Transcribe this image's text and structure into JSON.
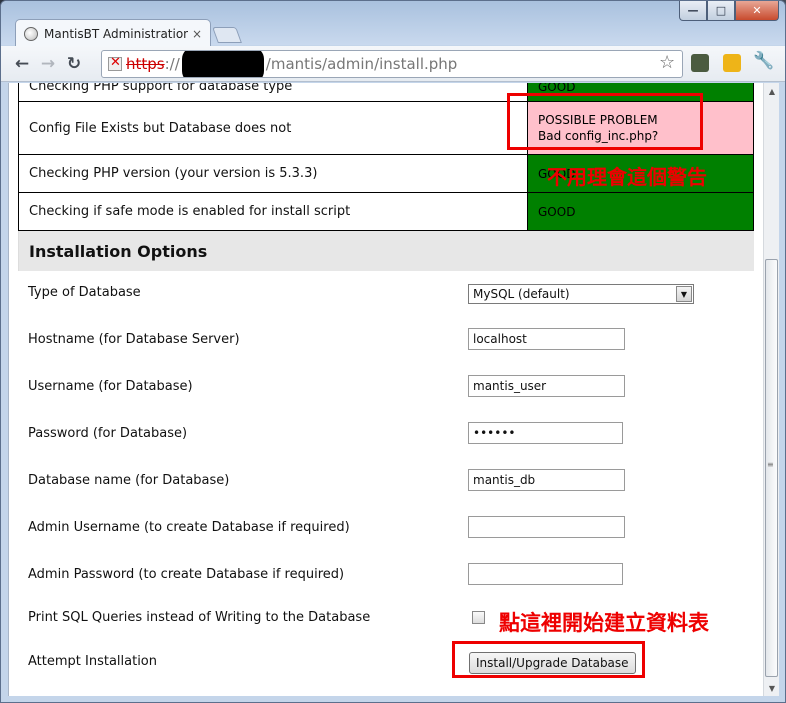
{
  "browser": {
    "tab_title": "MantisBT Administration -",
    "tab_close": "×",
    "url_scheme": "https",
    "url_sep": "://",
    "url_path": "/mantis/admin/install.php",
    "nav_back": "←",
    "nav_forward": "→",
    "nav_reload": "↻",
    "star": "☆",
    "wrench": "🔧",
    "win_min": "—",
    "win_max": "□",
    "win_close": "✕"
  },
  "checks": [
    {
      "label": "Checking PHP support for database type",
      "status": "GOOD",
      "state": "good"
    },
    {
      "label": "Config File Exists but Database does not",
      "status_line1": "POSSIBLE PROBLEM",
      "status_line2": "Bad config_inc.php?",
      "state": "problem"
    },
    {
      "label": "Checking PHP version (your version is 5.3.3)",
      "status": "GOOD",
      "state": "good"
    },
    {
      "label": "Checking if safe mode is enabled for install script",
      "status": "GOOD",
      "state": "good"
    }
  ],
  "install_options": {
    "heading": "Installation Options",
    "type_of_database": {
      "label": "Type of Database",
      "selected": "MySQL (default)"
    },
    "hostname": {
      "label": "Hostname (for Database Server)",
      "value": "localhost"
    },
    "username": {
      "label": "Username (for Database)",
      "value": "mantis_user"
    },
    "password": {
      "label": "Password (for Database)",
      "value": "••••••"
    },
    "database_name": {
      "label": "Database name (for Database)",
      "value": "mantis_db"
    },
    "admin_username": {
      "label": "Admin Username (to create Database if required)",
      "value": ""
    },
    "admin_password": {
      "label": "Admin Password (to create Database if required)",
      "value": ""
    },
    "print_sql": {
      "label": "Print SQL Queries instead of Writing to the Database",
      "checked": false
    },
    "attempt": {
      "label": "Attempt Installation",
      "button": "Install/Upgrade Database"
    }
  },
  "annotations": {
    "ignore_warning": "不用理會這個警告",
    "click_to_create": "點這裡開始建立資料表"
  },
  "colors": {
    "good": "#008000",
    "problem": "#ffc0cb",
    "annotation": "#ee0000"
  }
}
